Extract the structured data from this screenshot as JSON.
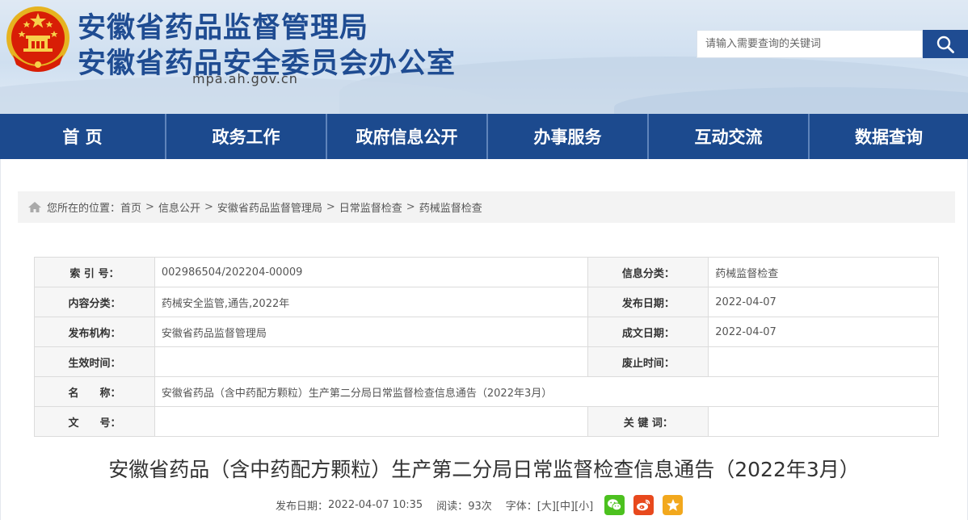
{
  "header": {
    "title_line1": "安徽省药品监督管理局",
    "title_line2": "安徽省药品安全委员会办公室",
    "domain": "mpa.ah.gov.cn",
    "search_placeholder": "请输入需要查询的关键词"
  },
  "nav": [
    {
      "label": "首 页"
    },
    {
      "label": "政务工作"
    },
    {
      "label": "政府信息公开"
    },
    {
      "label": "办事服务"
    },
    {
      "label": "互动交流"
    },
    {
      "label": "数据查询"
    }
  ],
  "breadcrumb": {
    "prefix": "您所在的位置：",
    "separator": ">",
    "items": [
      "首页",
      "信息公开",
      "安徽省药品监督管理局",
      "日常监督检查",
      "药械监督检查"
    ]
  },
  "meta": {
    "index_label": "索 引 号：",
    "index_value": "002986504/202204-00009",
    "info_class_label": "信息分类：",
    "info_class_value": "药械监督检查",
    "content_class_label": "内容分类：",
    "content_class_value": "药械安全监管,通告,2022年",
    "publish_date_label": "发布日期：",
    "publish_date_value": "2022-04-07",
    "publisher_label": "发布机构：",
    "publisher_value": "安徽省药品监督管理局",
    "created_date_label": "成文日期：",
    "created_date_value": "2022-04-07",
    "effective_label": "生效时间：",
    "effective_value": "",
    "abolish_label": "废止时间：",
    "abolish_value": "",
    "name_label": "名　　称：",
    "name_value": "安徽省药品（含中药配方颗粒）生产第二分局日常监督检查信息通告（2022年3月）",
    "doc_no_label": "文　　号：",
    "doc_no_value": "",
    "keywords_label": "关 键 词：",
    "keywords_value": ""
  },
  "article": {
    "title": "安徽省药品（含中药配方颗粒）生产第二分局日常监督检查信息通告（2022年3月）",
    "publish_label": "发布日期：",
    "publish_value": "2022-04-07 10:35",
    "read_label": "阅读：",
    "read_value": "93次",
    "font_label": "字体：",
    "font_large": "[大]",
    "font_medium": "[中]",
    "font_small": "[小]"
  },
  "share_icons": [
    "wechat-icon",
    "weibo-icon",
    "favorite-icon"
  ],
  "colors": {
    "brand_blue": "#1f4c92",
    "nav_blue": "#1c4a8e",
    "wechat_green": "#4cc11f",
    "weibo_red": "#e8491d",
    "favorite_orange": "#f2a81d"
  }
}
